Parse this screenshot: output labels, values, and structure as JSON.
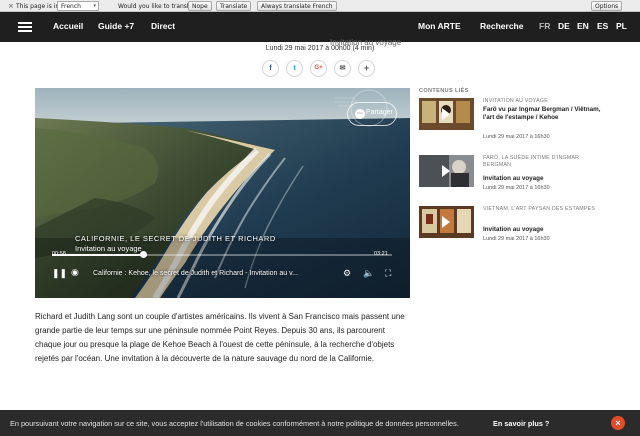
{
  "translate_bar": {
    "page_is_in_label": "This page is in",
    "page_language": "French",
    "question": "Would you like to translate it?",
    "nope_label": "Nope",
    "translate_label": "Translate",
    "always_label": "Always translate French",
    "options_label": "Options"
  },
  "nav": {
    "items": [
      "Accueil",
      "Guide +7",
      "Direct"
    ],
    "my_arte": "Mon ARTE",
    "search": "Recherche",
    "languages": [
      "FR",
      "DE",
      "EN",
      "ES",
      "PL"
    ],
    "active_language": "FR",
    "faded_subtitle": "Invitation au voyage"
  },
  "article_meta": {
    "date": "Lundi 29 mai 2017 à 00h00 (4 min)",
    "share_icons": [
      "facebook-icon",
      "twitter-icon",
      "google-plus-icon",
      "mail-icon",
      "plus-icon"
    ],
    "share_glyphs": [
      "f",
      "t",
      "G+",
      "✉",
      "+"
    ]
  },
  "video": {
    "share_label": "Partager",
    "title_line1": "Californie, le secret de Judith et Richard",
    "title_line2": "Invitation au voyage",
    "time_elapsed": "00:58",
    "time_total": "03:21",
    "progress": 0.27,
    "control_title": "Californie : Kehoe, le secret de Judith et Richard - Invitation au v...",
    "colors": {
      "accent": "#ffffff"
    }
  },
  "article_text": "Richard et Judith Lang sont un couple d'artistes américains. Ils vivent à San Francisco mais passent une grande partie de leur temps sur une péninsule nommée Point Reyes. Depuis 30 ans, ils parcourent chaque jour ou presque la plage de Kehoe Beach à l'ouest de cette péninsule, à la recherche d'objets rejetés par l'océan. Une invitation à la découverte de la nature sauvage du nord de la Californie.",
  "sidebar": {
    "heading": "CONTENUS LIÉS",
    "items": [
      {
        "category": "INVITATION AU VOYAGE",
        "title": "Farö vu par Ingmar Bergman / Viêtnam, l'art de l'estampe / Kehoe",
        "date": "Lundi 29 mai 2017 à 16h30"
      },
      {
        "category": "FARÖ, LA SUÈDE INTIME D'INGMAR BERGMAN",
        "title": "Invitation au voyage",
        "date": "Lundi 29 mai 2017 à 16h30"
      },
      {
        "category": "VIETNAM, L'ART PAYSAN DES ESTAMPES",
        "title": "Invitation au voyage",
        "date": "Lundi 29 mai 2017 à 16h30"
      }
    ]
  },
  "cookie_bar": {
    "message": "En poursuivant votre navigation sur ce site, vous acceptez l'utilisation de cookies conformément à notre politique de données personnelles.",
    "more_label": "En savoir plus ?",
    "close_glyph": "×"
  }
}
